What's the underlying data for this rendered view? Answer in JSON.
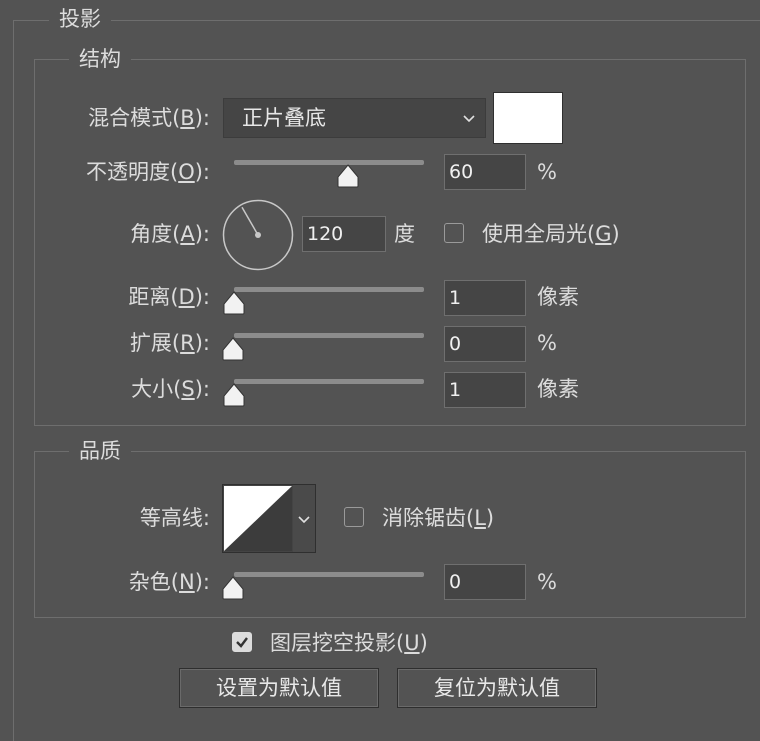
{
  "dialog": {
    "title": "投影",
    "structure": {
      "legend": "结构",
      "blend_mode": {
        "label": "混合模式(",
        "key": "B",
        "tail": "):",
        "value": "正片叠底"
      },
      "opacity": {
        "label": "不透明度(",
        "key": "O",
        "tail": "):",
        "value": "60",
        "unit": "%",
        "fraction": 0.6
      },
      "angle": {
        "label": "角度(",
        "key": "A",
        "tail": "):",
        "value": "120",
        "unit": "度",
        "degrees": 120,
        "global_light": {
          "label": "使用全局光(",
          "key": "G",
          "tail": ")",
          "checked": false
        }
      },
      "distance": {
        "label": "距离(",
        "key": "D",
        "tail": "):",
        "value": "1",
        "unit": "像素",
        "fraction": 0.0
      },
      "spread": {
        "label": "扩展(",
        "key": "R",
        "tail": "):",
        "value": "0",
        "unit": "%",
        "fraction": 0.0
      },
      "size": {
        "label": "大小(",
        "key": "S",
        "tail": "):",
        "value": "1",
        "unit": "像素",
        "fraction": 0.0
      }
    },
    "quality": {
      "legend": "品质",
      "contour": {
        "label": "等高线:",
        "anti_alias": {
          "label": "消除锯齿(",
          "key": "L",
          "tail": ")",
          "checked": false
        }
      },
      "noise": {
        "label": "杂色(",
        "key": "N",
        "tail": "):",
        "value": "0",
        "unit": "%",
        "fraction": 0.0
      }
    },
    "knockout": {
      "label": "图层挖空投影(",
      "key": "U",
      "tail": ")",
      "checked": true
    },
    "buttons": {
      "make_default": "设置为默认值",
      "reset_default": "复位为默认值"
    }
  },
  "colors": {
    "shadow_color": "#ffffff",
    "panel_bg": "#535353"
  }
}
